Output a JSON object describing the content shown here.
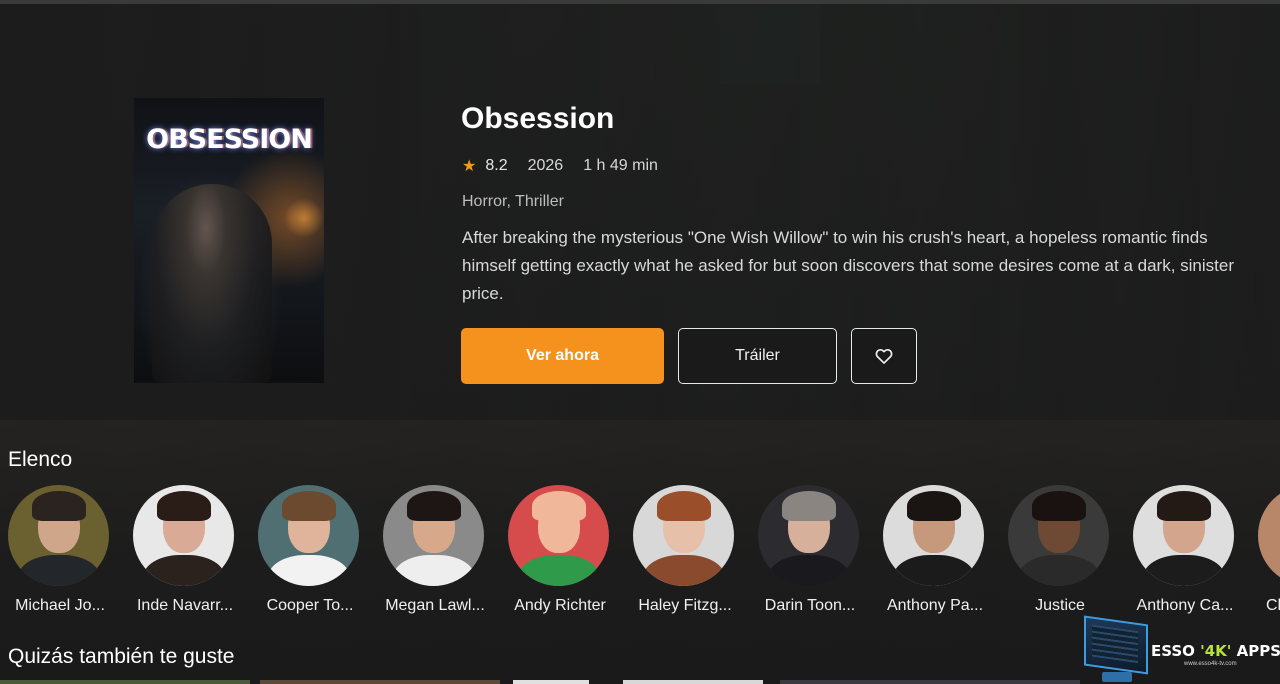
{
  "movie": {
    "title": "Obsession",
    "poster_title": "OBSESSION",
    "rating": "8.2",
    "year": "2026",
    "runtime": "1 h 49 min",
    "genres": "Horror, Thriller",
    "overview": "After breaking the mysterious \"One Wish Willow\" to win his crush's heart, a hopeless romantic finds himself getting exactly what he asked for but soon discovers that some desires come at a dark, sinister price."
  },
  "actions": {
    "watch_label": "Ver ahora",
    "trailer_label": "Tráiler",
    "favorite_icon": "heart-icon"
  },
  "cast": {
    "title": "Elenco",
    "members": [
      {
        "name": "Michael Jo..."
      },
      {
        "name": "Inde Navarr..."
      },
      {
        "name": "Cooper To..."
      },
      {
        "name": "Megan Lawl..."
      },
      {
        "name": "Andy Richter"
      },
      {
        "name": "Haley Fitzg..."
      },
      {
        "name": "Darin Toon..."
      },
      {
        "name": "Anthony Pa..."
      },
      {
        "name": "Justice"
      },
      {
        "name": "Anthony Ca..."
      },
      {
        "name": "Ch"
      }
    ]
  },
  "recommendations": {
    "title": "Quizás también te guste"
  },
  "watermark": {
    "text_prefix": "ESSO ",
    "text_accent": "'4K'",
    "text_suffix": " APPS",
    "url": "www.esso4k-tv.com"
  },
  "colors": {
    "accent": "#f5921e",
    "star": "#f39a1d",
    "background": "#1c1c1c"
  }
}
